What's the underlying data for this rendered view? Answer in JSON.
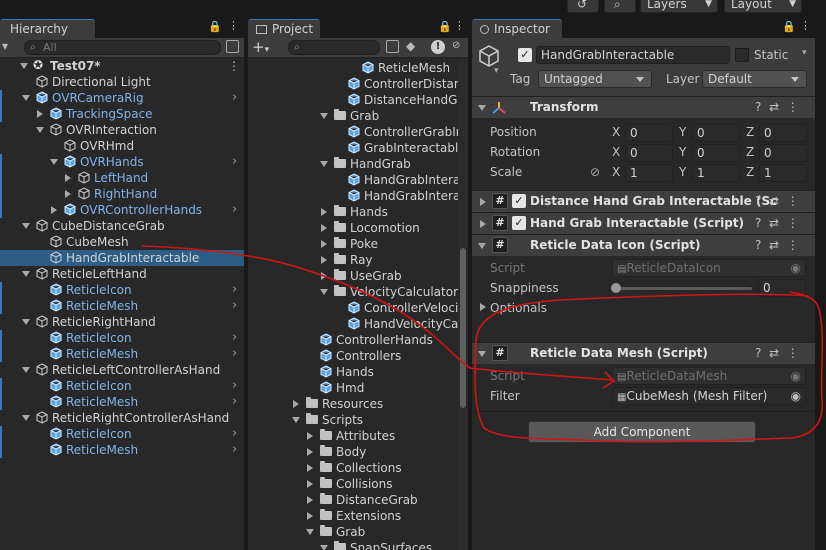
{
  "topbar": {
    "history_icon": "history-icon",
    "search_icon": "search-icon",
    "layers_label": "Layers",
    "layout_label": "Layout"
  },
  "hierarchy": {
    "tab_label": "Hierarchy",
    "search_placeholder": "All",
    "scene_name": "Test07*",
    "items": [
      {
        "label": "Directional Light",
        "blue": false,
        "selected": false
      },
      {
        "label": "OVRCameraRig",
        "blue": true,
        "selected": false
      },
      {
        "label": "TrackingSpace",
        "blue": true,
        "selected": false
      },
      {
        "label": "OVRInteraction",
        "blue": false,
        "selected": false
      },
      {
        "label": "OVRHmd",
        "blue": false,
        "selected": false
      },
      {
        "label": "OVRHands",
        "blue": true,
        "selected": false
      },
      {
        "label": "LeftHand",
        "blue": true,
        "selected": false
      },
      {
        "label": "RightHand",
        "blue": true,
        "selected": false
      },
      {
        "label": "OVRControllerHands",
        "blue": true,
        "selected": false
      },
      {
        "label": "CubeDistanceGrab",
        "blue": false,
        "selected": false
      },
      {
        "label": "CubeMesh",
        "blue": false,
        "selected": false
      },
      {
        "label": "HandGrabInteractable",
        "blue": false,
        "selected": true
      },
      {
        "label": "ReticleLeftHand",
        "blue": false,
        "selected": false
      },
      {
        "label": "ReticleIcon",
        "blue": true,
        "selected": false
      },
      {
        "label": "ReticleMesh",
        "blue": true,
        "selected": false
      },
      {
        "label": "ReticleRightHand",
        "blue": false,
        "selected": false
      },
      {
        "label": "ReticleIcon",
        "blue": true,
        "selected": false
      },
      {
        "label": "ReticleMesh",
        "blue": true,
        "selected": false
      },
      {
        "label": "ReticleLeftControllerAsHand",
        "blue": false,
        "selected": false
      },
      {
        "label": "ReticleIcon",
        "blue": true,
        "selected": false
      },
      {
        "label": "ReticleMesh",
        "blue": true,
        "selected": false
      },
      {
        "label": "ReticleRightControllerAsHand",
        "blue": false,
        "selected": false
      },
      {
        "label": "ReticleIcon",
        "blue": true,
        "selected": false
      },
      {
        "label": "ReticleMesh",
        "blue": true,
        "selected": false
      }
    ]
  },
  "project": {
    "tab_label": "Project",
    "add_label": "+",
    "hidden_count": "9",
    "items": [
      {
        "label": "ReticleMesh",
        "kind": "prefab"
      },
      {
        "label": "ControllerDistan",
        "kind": "prefab"
      },
      {
        "label": "DistanceHandGr",
        "kind": "prefab"
      },
      {
        "label": "Grab",
        "kind": "folder"
      },
      {
        "label": "ControllerGrabIn",
        "kind": "prefab"
      },
      {
        "label": "GrabInteractable",
        "kind": "prefab"
      },
      {
        "label": "HandGrab",
        "kind": "folder"
      },
      {
        "label": "HandGrabInterac",
        "kind": "prefab"
      },
      {
        "label": "HandGrabInterac",
        "kind": "prefab"
      },
      {
        "label": "Hands",
        "kind": "folder"
      },
      {
        "label": "Locomotion",
        "kind": "folder"
      },
      {
        "label": "Poke",
        "kind": "folder"
      },
      {
        "label": "Ray",
        "kind": "folder"
      },
      {
        "label": "UseGrab",
        "kind": "folder"
      },
      {
        "label": "VelocityCalculator",
        "kind": "folder"
      },
      {
        "label": "ControllerVeloci",
        "kind": "prefab"
      },
      {
        "label": "HandVelocityCa",
        "kind": "prefab"
      },
      {
        "label": "ControllerHands",
        "kind": "prefab"
      },
      {
        "label": "Controllers",
        "kind": "prefab"
      },
      {
        "label": "Hands",
        "kind": "prefab"
      },
      {
        "label": "Hmd",
        "kind": "prefab"
      },
      {
        "label": "Resources",
        "kind": "folder"
      },
      {
        "label": "Scripts",
        "kind": "folder"
      },
      {
        "label": "Attributes",
        "kind": "folder"
      },
      {
        "label": "Body",
        "kind": "folder"
      },
      {
        "label": "Collections",
        "kind": "folder"
      },
      {
        "label": "Collisions",
        "kind": "folder"
      },
      {
        "label": "DistanceGrab",
        "kind": "folder"
      },
      {
        "label": "Extensions",
        "kind": "folder"
      },
      {
        "label": "Grab",
        "kind": "folder"
      },
      {
        "label": "SnapSurfaces",
        "kind": "folder"
      }
    ]
  },
  "inspector": {
    "tab_label": "Inspector",
    "object_name": "HandGrabInteractable",
    "static_label": "Static",
    "tag_label": "Tag",
    "tag_value": "Untagged",
    "layer_label": "Layer",
    "layer_value": "Default",
    "transform": {
      "title": "Transform",
      "position_label": "Position",
      "rotation_label": "Rotation",
      "scale_label": "Scale",
      "x_label": "X",
      "y_label": "Y",
      "z_label": "Z",
      "position": [
        "0",
        "0",
        "0"
      ],
      "rotation": [
        "0",
        "0",
        "0"
      ],
      "scale": [
        "1",
        "1",
        "1"
      ]
    },
    "components": [
      {
        "title": "Distance Hand Grab Interactable (Sc",
        "checked": true
      },
      {
        "title": "Hand Grab Interactable (Script)",
        "checked": true
      },
      {
        "title": "Reticle Data Icon (Script)",
        "checked": false
      },
      {
        "title": "Reticle Data Mesh (Script)",
        "checked": false
      }
    ],
    "reticle_icon": {
      "script_label": "Script",
      "script_value": "ReticleDataIcon",
      "snappiness_label": "Snappiness",
      "snappiness_value": "0",
      "snappiness_fraction": 0,
      "optionals_label": "Optionals"
    },
    "reticle_mesh": {
      "script_label": "Script",
      "script_value": "ReticleDataMesh",
      "filter_label": "Filter",
      "filter_value": "CubeMesh (Mesh Filter)"
    },
    "add_component_label": "Add Component"
  },
  "annotation": {
    "stroke_color": "#d21414"
  }
}
